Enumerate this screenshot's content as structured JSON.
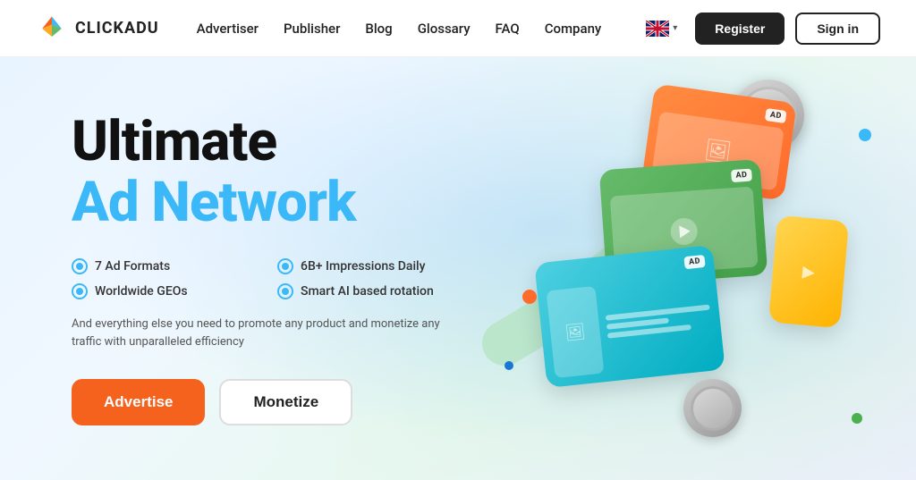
{
  "brand": {
    "name": "CLICKADU",
    "logo_alt": "Clickadu Logo"
  },
  "nav": {
    "links": [
      {
        "label": "Advertiser",
        "href": "#"
      },
      {
        "label": "Publisher",
        "href": "#"
      },
      {
        "label": "Blog",
        "href": "#"
      },
      {
        "label": "Glossary",
        "href": "#"
      },
      {
        "label": "FAQ",
        "href": "#"
      },
      {
        "label": "Company",
        "href": "#"
      }
    ],
    "register_label": "Register",
    "signin_label": "Sign in",
    "lang": "EN"
  },
  "hero": {
    "title_main": "Ultimate",
    "title_sub": "Ad Network",
    "features": [
      {
        "label": "7 Ad Formats"
      },
      {
        "label": "6B+ Impressions Daily"
      },
      {
        "label": "Worldwide GEOs"
      },
      {
        "label": "Smart AI based rotation"
      }
    ],
    "sub_text": "And everything else you need to promote any product and monetize any traffic with unparalleled efficiency",
    "btn_advertise": "Advertise",
    "btn_monetize": "Monetize"
  },
  "ad_badges": {
    "ad_label": "AD"
  },
  "colors": {
    "accent_blue": "#3bb8f8",
    "accent_orange": "#f5621e",
    "dark": "#111111"
  }
}
